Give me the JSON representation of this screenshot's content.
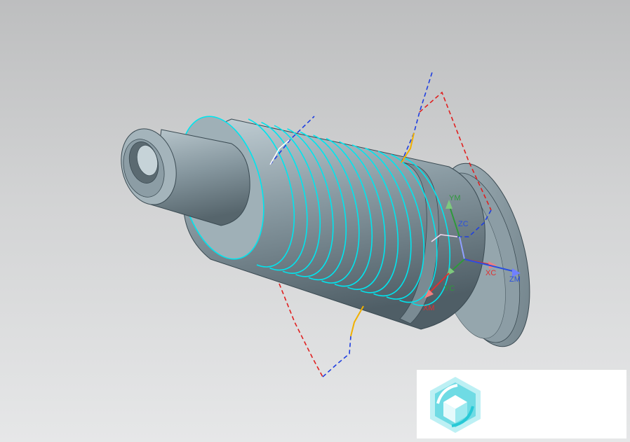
{
  "viewport": {
    "background_top": "#bdbebf",
    "background_bottom": "#e6e7e8"
  },
  "model": {
    "body_color": "#8a9aa2",
    "thread_color": "#00e5ee",
    "edge_color": "#3a4a52"
  },
  "csys": {
    "labels": {
      "ym": "YM",
      "zc": "ZC",
      "xc": "XC",
      "yc": "YC",
      "xm": "XM",
      "zm": "ZM"
    },
    "colors": {
      "x": "#e03030",
      "y": "#2e9a3a",
      "z": "#2a50e0"
    }
  },
  "logo": {
    "icon": "cube-logo-icon",
    "accent": "#27c9d6"
  }
}
